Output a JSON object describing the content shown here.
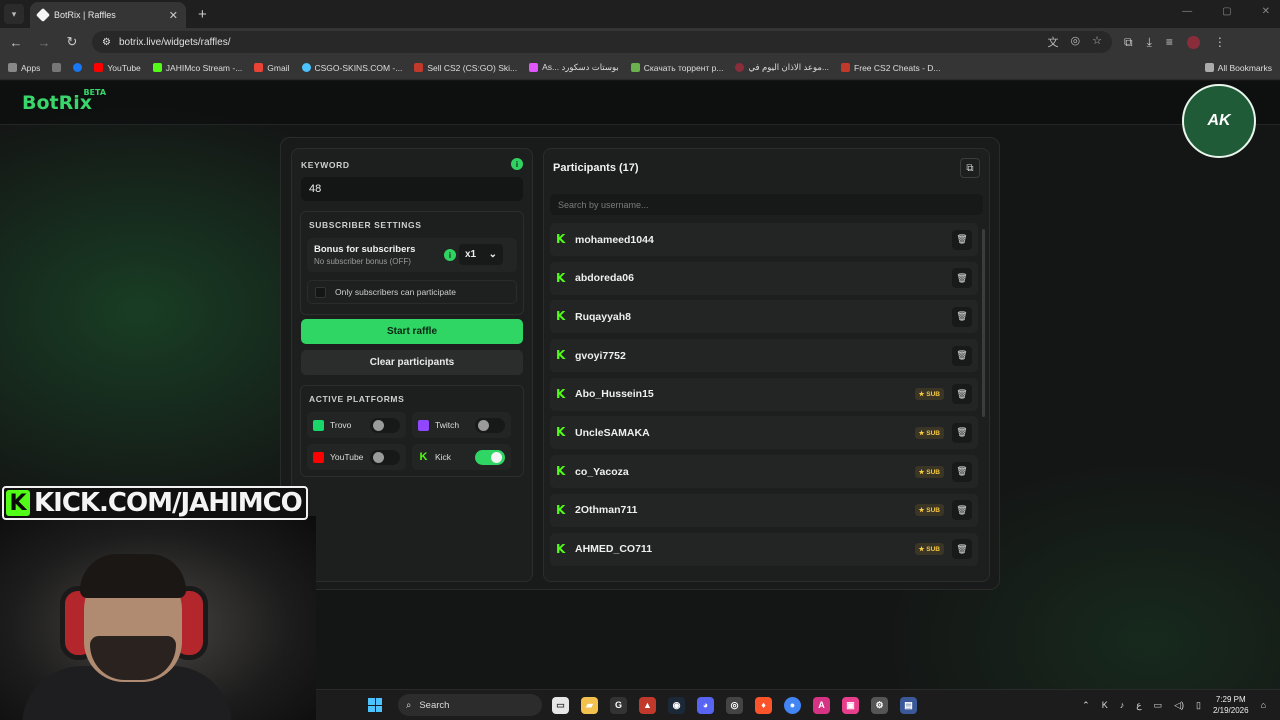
{
  "browser": {
    "tab_title": "BotRix | Raffles",
    "tab_close": "✕",
    "new_tab": "+",
    "url": "botrix.live/widgets/raffles/",
    "all_bookmarks": "All Bookmarks",
    "bookmarks": [
      {
        "label": "Apps",
        "color": "#888888"
      },
      {
        "label": "",
        "color": "#777777"
      },
      {
        "label": "",
        "color": "#1877f2"
      },
      {
        "label": "YouTube",
        "color": "#ff0000"
      },
      {
        "label": "JAHIMco Stream -...",
        "color": "#53fc18"
      },
      {
        "label": "Gmail",
        "color": "#ea4335"
      },
      {
        "label": "CSGO-SKINS.COM -...",
        "color": "#4cc2ff"
      },
      {
        "label": "Sell CS2 (CS:GO) Ski...",
        "color": "#c0392b"
      },
      {
        "label": "As... بوستات دسكورد",
        "color": "#e056fd"
      },
      {
        "label": "Скачать торрент р...",
        "color": "#6ab04c"
      },
      {
        "label": "موعد الاذان اليوم في...",
        "color": "#8a2d3a"
      },
      {
        "label": "Free CS2 Cheats - D...",
        "color": "#c0392b"
      }
    ]
  },
  "site": {
    "logo": "BotRix",
    "beta": "BETA",
    "stream_badge": "AK"
  },
  "raffle": {
    "keyword_label": "KEYWORD",
    "info_glyph": "i",
    "keyword_value": "48",
    "subscriber_settings_label": "SUBSCRIBER SETTINGS",
    "bonus_title": "Bonus for subscribers",
    "bonus_subtitle": "No subscriber bonus (OFF)",
    "multiplier": "x1",
    "only_subscribers": "Only subscribers can participate",
    "start_button": "Start raffle",
    "clear_button": "Clear participants",
    "active_platforms_label": "ACTIVE PLATFORMS",
    "platforms": [
      {
        "name": "Trovo",
        "enabled": false,
        "color": "#19d66b"
      },
      {
        "name": "Twitch",
        "enabled": false,
        "color": "#9146ff"
      },
      {
        "name": "YouTube",
        "enabled": false,
        "color": "#ff0000"
      },
      {
        "name": "Kick",
        "enabled": true,
        "color": "#53fc18"
      }
    ]
  },
  "participants": {
    "title": "Participants (17)",
    "search_placeholder": "Search by username...",
    "sub_badge": "★ SUB",
    "list": [
      {
        "name": "mohameed1044",
        "sub": false
      },
      {
        "name": "abdoreda06",
        "sub": false
      },
      {
        "name": "Ruqayyah8",
        "sub": false
      },
      {
        "name": "gvoyi7752",
        "sub": false
      },
      {
        "name": "Abo_Hussein15",
        "sub": true
      },
      {
        "name": "UncleSAMAKA",
        "sub": true
      },
      {
        "name": "co_Yacoza",
        "sub": true
      },
      {
        "name": "2Othman711",
        "sub": true
      },
      {
        "name": "AHMED_CO711",
        "sub": true
      }
    ]
  },
  "stream": {
    "kick_logo": "K",
    "kick_text": "KICK.COM/JAHIMCO"
  },
  "taskbar": {
    "search_label": "Search",
    "lang": "ع",
    "time": "7:29 PM",
    "date": "2/19/2026"
  }
}
